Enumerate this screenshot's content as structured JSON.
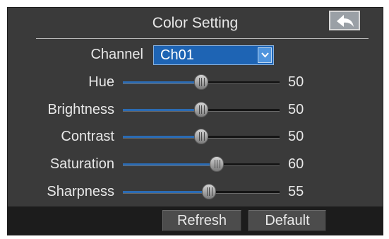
{
  "window": {
    "title": "Color Setting",
    "back_icon": "back-arrow-icon"
  },
  "channel": {
    "label": "Channel",
    "value": "Ch01",
    "dropdown_icon": "chevron-down-icon"
  },
  "settings": [
    {
      "label": "Hue",
      "value": "50",
      "level": 0.5
    },
    {
      "label": "Brightness",
      "value": "50",
      "level": 0.5
    },
    {
      "label": "Contrast",
      "value": "50",
      "level": 0.5
    },
    {
      "label": "Saturation",
      "value": "60",
      "level": 0.6
    },
    {
      "label": "Sharpness",
      "value": "55",
      "level": 0.55
    }
  ],
  "footer": {
    "refresh_label": "Refresh",
    "default_label": "Default"
  },
  "colors": {
    "panel": "#3a3a3a",
    "accent": "#1e64b4",
    "slider_fill": "#2b6bb3",
    "footer": "#1c1c1c",
    "text": "#e8e8e8"
  }
}
